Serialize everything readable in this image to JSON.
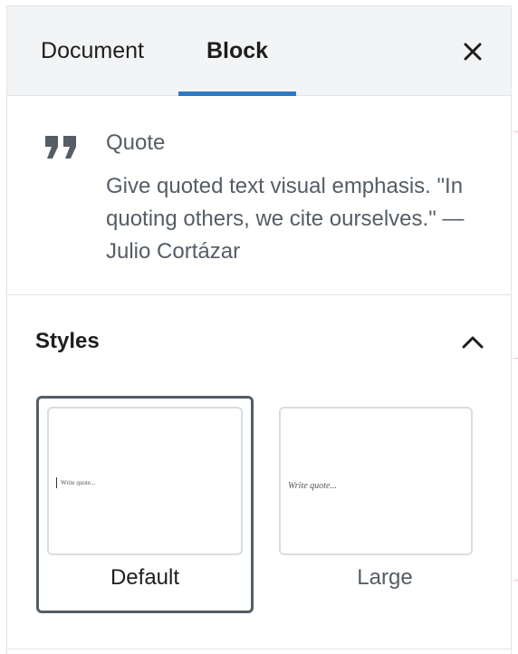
{
  "tabs": {
    "document": "Document",
    "block": "Block"
  },
  "icons": {
    "close": "close-icon",
    "quote": "quote-icon",
    "chevron": "chevron-up-icon"
  },
  "colors": {
    "accent": "#2f78c4",
    "header_bg": "#f3f4f5",
    "muted_text": "#555d66",
    "border": "#e2e4e7"
  },
  "block_card": {
    "title": "Quote",
    "description": "Give quoted text visual emphasis. \"In quoting others, we cite ourselves.\" — Julio Cortázar"
  },
  "styles_panel": {
    "title": "Styles",
    "expanded": true,
    "options": [
      {
        "label": "Default",
        "preview_text": "Write quote...",
        "selected": true
      },
      {
        "label": "Large",
        "preview_text": "Write quote...",
        "selected": false
      }
    ]
  }
}
